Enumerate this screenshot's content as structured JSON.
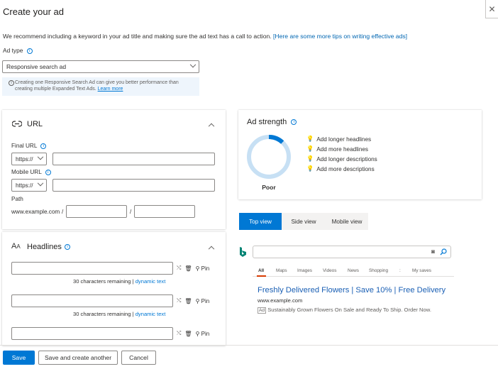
{
  "header": {
    "title": "Create your ad",
    "close_glyph": "✕",
    "intro_text": "We recommend including a keyword in your ad title and making sure the ad text has a call to action.",
    "intro_link": "[Here are some more tips on writing effective ads]"
  },
  "ad_type": {
    "label": "Ad type",
    "selected": "Responsive search ad",
    "info_text": "Creating one Responsive Search Ad can give you better performance than creating multiple Expanded Text Ads.",
    "info_link": "Learn more"
  },
  "url_section": {
    "title": "URL",
    "final_url_label": "Final URL",
    "final_protocol": "https://",
    "final_url_value": "",
    "mobile_url_label": "Mobile URL",
    "mobile_protocol": "https://",
    "mobile_url_value": "",
    "path_label": "Path",
    "path_prefix": "www.example.com",
    "path_sep1": "/",
    "path_sep2": "/",
    "path1_value": "",
    "path2_value": ""
  },
  "headlines": {
    "title": "Headlines",
    "items": [
      {
        "value": "",
        "remaining": "30 characters remaining",
        "sep": "|",
        "link": "dynamic text",
        "pin": "Pin"
      },
      {
        "value": "",
        "remaining": "30 characters remaining",
        "sep": "|",
        "link": "dynamic text",
        "pin": "Pin"
      },
      {
        "value": "",
        "pin": "Pin"
      }
    ]
  },
  "ad_strength": {
    "title": "Ad strength",
    "rating": "Poor",
    "progress_fraction": 0.12,
    "tips": [
      "Add longer headlines",
      "Add more headlines",
      "Add longer descriptions",
      "Add more descriptions"
    ],
    "ring_color": "#0078d4",
    "ring_track_color": "#c7e0f4"
  },
  "preview": {
    "tabs": [
      "Top view",
      "Side view",
      "Mobile view"
    ],
    "active_tab": "Top view",
    "search_value": "",
    "nav": [
      "All",
      "Maps",
      "Images",
      "Videos",
      "News",
      "Shopping",
      ":",
      "My saves"
    ],
    "ad_title": "Freshly Delivered Flowers | Save 10% | Free Delivery",
    "ad_url": "www.example.com",
    "ad_badge": "Ad",
    "ad_description": "Sustainably Grown Flowers On Sale and Ready To Ship. Order Now."
  },
  "footer": {
    "save": "Save",
    "save_another": "Save and create another",
    "cancel": "Cancel"
  },
  "colors": {
    "primary": "#0078d4",
    "link": "#0066b2"
  }
}
